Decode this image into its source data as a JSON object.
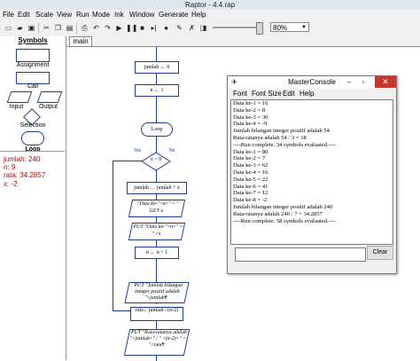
{
  "window": {
    "title": "Raptor - 4.4.rap"
  },
  "menu": [
    "File",
    "Edit",
    "Scale",
    "View",
    "Run",
    "Mode",
    "Ink",
    "Window",
    "Generate",
    "Help"
  ],
  "toolbar": {
    "zoom": "80%"
  },
  "symbols": {
    "header": "Symbols",
    "items": [
      "Assignment",
      "Call",
      "Input",
      "Output",
      "Selection",
      "Loop"
    ]
  },
  "watch": [
    {
      "text": "jumlah: 240"
    },
    {
      "text": "n: 9"
    },
    {
      "text": "rata: 34.2857"
    },
    {
      "text": "x: -2"
    }
  ],
  "tab": {
    "label": "main"
  },
  "flowchart": {
    "assign1": "jumlah ← 0",
    "assign2": "n ← 1",
    "loop": "Loop",
    "cond": "x < 0",
    "yes": "Yes",
    "no": "No",
    "assign3": "jumlah ← jumlah + x",
    "input1": "\"Data ke-\"+n+\" = \" GET x",
    "output1": "PUT \"Data ke-\"+n+\" = \" +x",
    "assign4": "n ← n + 1",
    "output2": "PUT \"Jumlah bilangan integer positif adalah \"+jumlah¶",
    "assign5": "rata←jumlah / (n-2)",
    "output3": "PUT \"Rata-ratanya adalah \"+jumlah+\" / \" +(n-2)+\" = \"+rata¶"
  },
  "console": {
    "title": "MasterConsole",
    "menu": [
      "Font",
      "Font Size",
      "Edit",
      "Help"
    ],
    "lines": [
      "Data ke-1 = 16",
      "Data ke-2 = 8",
      "Data ke-3 = 30",
      "Data ke-4 = -9",
      "Jumlah bilangan integer positif adalah 54",
      "Rata-ratanya adalah 54 / 3 = 18",
      "----Run complete.  34 symbols evaluated.----",
      "Data ke-1 = 80",
      "Data ke-2 = 7",
      "Data ke-3 = 62",
      "Data ke-4 = 16",
      "Data ke-5 = 22",
      "Data ke-6 = 41",
      "Data ke-7 = 12",
      "Data ke-8 = -2",
      "Jumlah bilangan integer positif adalah 240",
      "Rata-ratanya adalah 240 / 7 = 34.2857",
      "----Run complete.  58 symbols evaluated.----"
    ],
    "input_value": "",
    "clear_label": "Clear"
  }
}
